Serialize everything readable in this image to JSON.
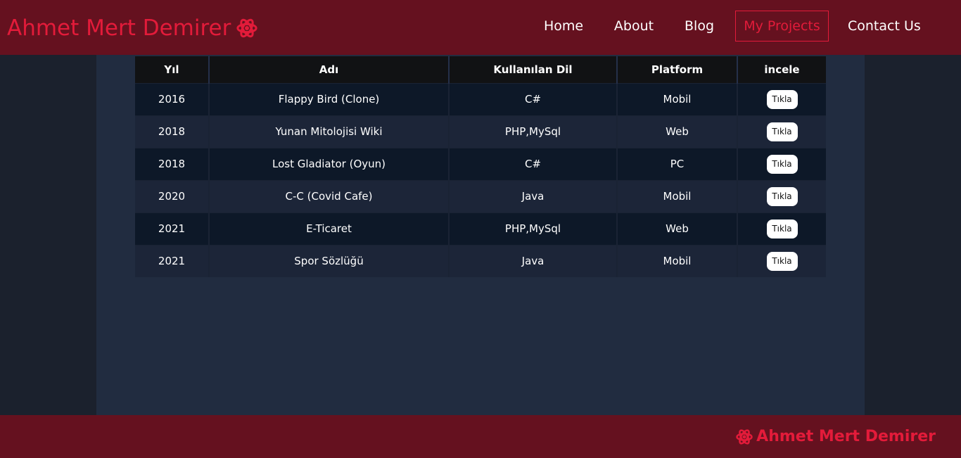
{
  "brand": {
    "name": "Ahmet Mert Demirer",
    "icon": "atom-icon",
    "color": "#e31b3a"
  },
  "nav": {
    "items": [
      {
        "label": "Home"
      },
      {
        "label": "About"
      },
      {
        "label": "Blog"
      },
      {
        "label": "My Projects",
        "active": true
      },
      {
        "label": "Contact Us"
      }
    ]
  },
  "table": {
    "headers": [
      "Yıl",
      "Adı",
      "Kullanılan Dil",
      "Platform",
      "incele"
    ],
    "rows": [
      {
        "year": "2016",
        "name": "Flappy Bird (Clone)",
        "language": "C#",
        "platform": "Mobil",
        "action": "Tıkla"
      },
      {
        "year": "2018",
        "name": "Yunan Mitolojisi Wiki",
        "language": "PHP,MySql",
        "platform": "Web",
        "action": "Tıkla"
      },
      {
        "year": "2018",
        "name": "Lost Gladiator (Oyun)",
        "language": "C#",
        "platform": "PC",
        "action": "Tıkla"
      },
      {
        "year": "2020",
        "name": "C-C (Covid Cafe)",
        "language": "Java",
        "platform": "Mobil",
        "action": "Tıkla"
      },
      {
        "year": "2021",
        "name": "E-Ticaret",
        "language": "PHP,MySql",
        "platform": "Web",
        "action": "Tıkla"
      },
      {
        "year": "2021",
        "name": "Spor Sözlüğü",
        "language": "Java",
        "platform": "Mobil",
        "action": "Tıkla"
      }
    ]
  },
  "footer": {
    "brand": "Ahmet Mert Demirer",
    "icon": "atom-icon"
  },
  "colors": {
    "header_bg": "#65111f",
    "accent": "#e31b3a",
    "content_bg": "#212c40",
    "page_bg": "#1b212d"
  }
}
